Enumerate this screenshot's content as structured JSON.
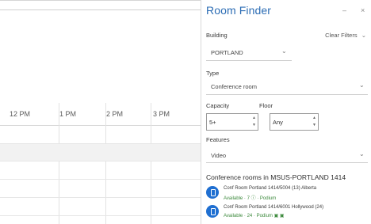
{
  "calendar": {
    "times": [
      "12 PM",
      "1 PM",
      "2 PM",
      "3 PM"
    ]
  },
  "pane": {
    "title": "Room Finder",
    "controls": [
      "–",
      "×"
    ],
    "building_label": "Building",
    "clear_filters": "Clear Filters",
    "building_value": "PORTLAND",
    "type_label": "Type",
    "type_value": "Conference room",
    "capacity_label": "Capacity",
    "capacity_value": "5+",
    "floor_label": "Floor",
    "floor_value": "Any",
    "features_label": "Features",
    "features_value": "Video",
    "results_title": "Conference rooms in MSUS-PORTLAND 1414",
    "rooms": [
      {
        "name": "Conf Room Portland 1414/5004 (13) Alberta",
        "status": "Available · 7 ⓘ · Podium"
      },
      {
        "name": "Conf Room Portland 1414/6001 Hollywood (24)",
        "status": "Available · 24 · Podium ▣ ▣"
      }
    ]
  }
}
